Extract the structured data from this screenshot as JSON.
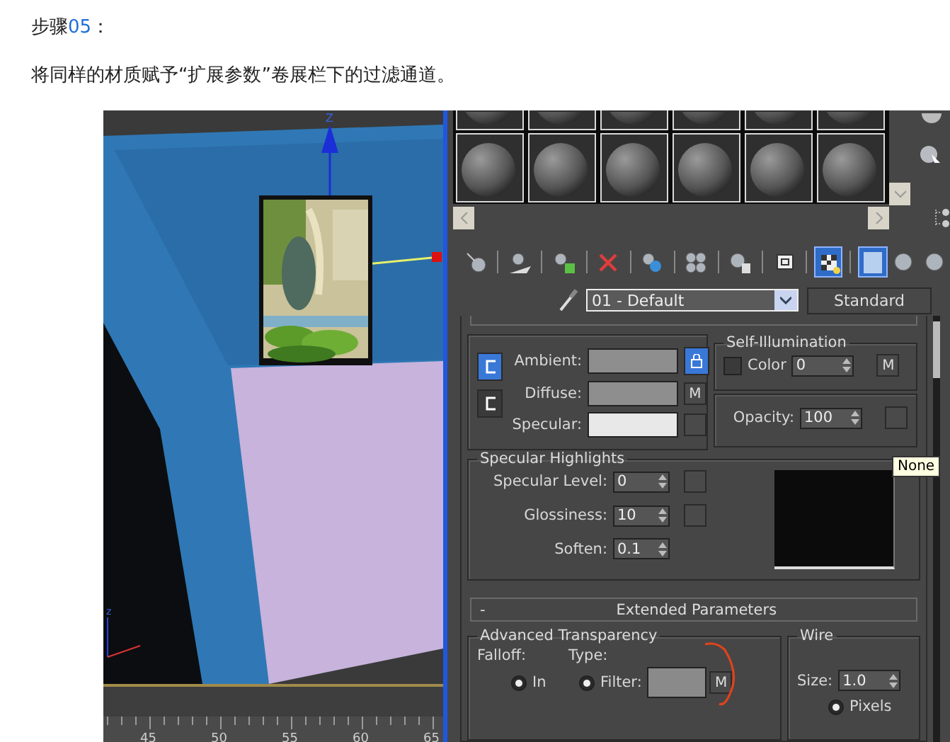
{
  "article": {
    "step_label": "步骤",
    "step_number": "05",
    "step_colon": "：",
    "instruction": "将同样的材质赋予“扩展参数”卷展栏下的过滤通道。"
  },
  "viewport": {
    "gizmo_label": "Z",
    "tripod_label": "z",
    "timeline_ticks": [
      "45",
      "50",
      "55",
      "60",
      "65"
    ]
  },
  "material_editor": {
    "toolbar": [
      {
        "selected": false
      },
      {
        "selected": false
      },
      {
        "selected": false
      },
      {
        "selected": false
      },
      {
        "selected": false
      },
      {
        "selected": false
      },
      {
        "selected": false
      },
      {
        "selected": false
      },
      {
        "selected": true
      },
      {
        "selected": true
      },
      {
        "selected": false
      },
      {
        "selected": false
      }
    ],
    "material_name": "01 - Default",
    "material_type": "Standard",
    "basic_parameters": {
      "locks": [
        {
          "selected": true
        },
        {
          "selected": false
        }
      ],
      "lock_toggle": {
        "selected": true
      },
      "colors": [
        {
          "label": "Ambient:",
          "color": "#8e8e8e"
        },
        {
          "label": "Diffuse:",
          "color": "#8e8e8e",
          "map_button": "M"
        },
        {
          "label": "Specular:",
          "color": "#e8e8e8"
        }
      ],
      "self_illumination": {
        "title": "Self-Illumination",
        "checked": false,
        "label": "Color",
        "value": "0",
        "map_button": "M"
      },
      "opacity": {
        "label": "Opacity:",
        "value": "100"
      }
    },
    "tooltip": "None",
    "specular_highlights": {
      "title": "Specular Highlights",
      "fields": [
        {
          "label": "Specular Level:",
          "value": "0"
        },
        {
          "label": "Glossiness:",
          "value": "10"
        },
        {
          "label": "Soften:",
          "value": "0.1"
        }
      ]
    },
    "extended_parameters": {
      "toggle": "-",
      "title": "Extended Parameters",
      "advanced_transparency": {
        "title": "Advanced Transparency",
        "falloff_label": "Falloff:",
        "type_label": "Type:",
        "falloff_options": [
          {
            "label": "In",
            "selected": true
          }
        ],
        "type_options": [
          {
            "label": "Filter:",
            "selected": true
          }
        ],
        "filter_map_button": "M"
      },
      "wire": {
        "title": "Wire",
        "size_label": "Size:",
        "size_value": "1.0",
        "units": [
          {
            "label": "Pixels",
            "selected": true
          }
        ]
      }
    }
  }
}
